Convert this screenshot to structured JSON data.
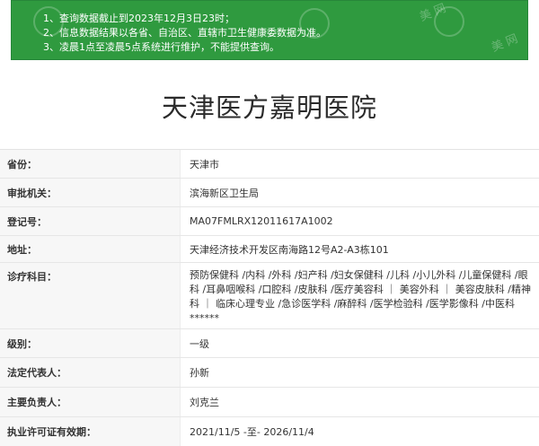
{
  "notice": {
    "lines": [
      "1、查询数据截止到2023年12月3日23时；",
      "2、信息数据结果以各省、自治区、直辖市卫生健康委数据为准。",
      "3、凌晨1点至凌晨5点系统进行维护，不能提供查询。"
    ],
    "watermark": "美 网"
  },
  "hospital": {
    "name": "天津医方嘉明医院"
  },
  "fields": [
    {
      "label": "省份：",
      "value": "天津市"
    },
    {
      "label": "审批机关：",
      "value": "滨海新区卫生局"
    },
    {
      "label": "登记号：",
      "value": "MA07FMLRX12011617A1002"
    },
    {
      "label": "地址：",
      "value": "天津经济技术开发区南海路12号A2-A3栋101"
    },
    {
      "label": "诊疗科目：",
      "value": "预防保健科 /内科 /外科 /妇产科 /妇女保健科 /儿科 /小儿外科 /儿童保健科 /眼科 /耳鼻咽喉科 /口腔科 /皮肤科 /医疗美容科 ｜ 美容外科 ｜ 美容皮肤科 /精神科 ｜ 临床心理专业 /急诊医学科 /麻醉科 /医学检验科 /医学影像科 /中医科******"
    },
    {
      "label": "级别：",
      "value": "一级"
    },
    {
      "label": "法定代表人：",
      "value": "孙新"
    },
    {
      "label": "主要负责人：",
      "value": "刘克兰"
    },
    {
      "label": "执业许可证有效期：",
      "value": "2021/11/5 -至- 2026/11/4"
    }
  ]
}
